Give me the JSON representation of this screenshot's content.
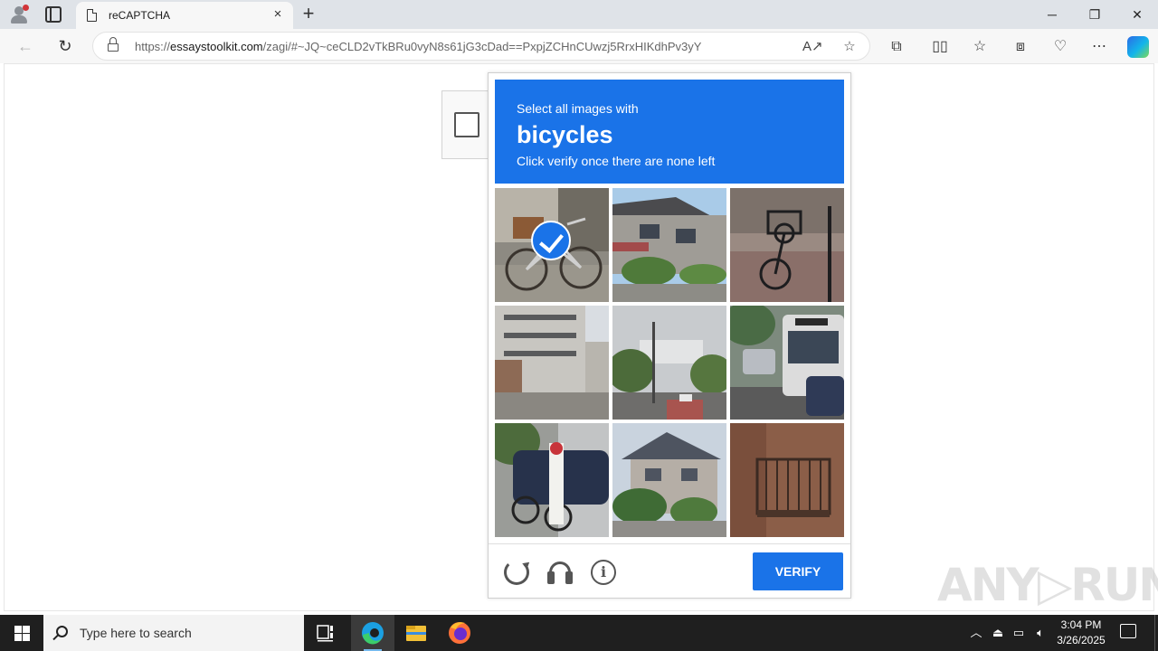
{
  "browser": {
    "tab": {
      "title": "reCAPTCHA",
      "close_icon": "×"
    },
    "new_tab_icon": "+",
    "window": {
      "minimize": "─",
      "restore": "❐",
      "close": "✕"
    },
    "address": {
      "scheme": "https://",
      "host": "essaystoolkit.com",
      "path": "/zagi/#~JQ~ceCLD2vTkBRu0vyN8s61jG3cDad==PxpjZCHnCUwzj5RrxHIKdhPv3yY"
    },
    "toolbar_icons": [
      "back-icon",
      "refresh-icon",
      "read-aloud-icon",
      "favorite-star-icon",
      "extensions-icon",
      "split-screen-icon",
      "favorites-icon",
      "collections-icon",
      "browser-essentials-icon",
      "more-icon",
      "copilot-icon"
    ]
  },
  "captcha": {
    "instruction_line1": "Select all images with",
    "keyword": "bicycles",
    "instruction_line3": "Click verify once there are none left",
    "tiles": [
      {
        "label": "bicycle with basket against wall",
        "selected": true
      },
      {
        "label": "row of houses",
        "selected": false
      },
      {
        "label": "bicycle on sidewalk",
        "selected": false
      },
      {
        "label": "apartment building",
        "selected": false
      },
      {
        "label": "street intersection",
        "selected": false
      },
      {
        "label": "bus on street",
        "selected": false
      },
      {
        "label": "parked bicycles and sign",
        "selected": false
      },
      {
        "label": "house with trees",
        "selected": false
      },
      {
        "label": "balcony",
        "selected": false
      }
    ],
    "verify_label": "VERIFY"
  },
  "watermark": "ANY▷RUN",
  "taskbar": {
    "search_placeholder": "Type here to search",
    "time": "3:04 PM",
    "date": "3/26/2025",
    "tray_icons": [
      "chevron-up-icon",
      "usb-icon",
      "network-icon",
      "volume-icon"
    ]
  }
}
